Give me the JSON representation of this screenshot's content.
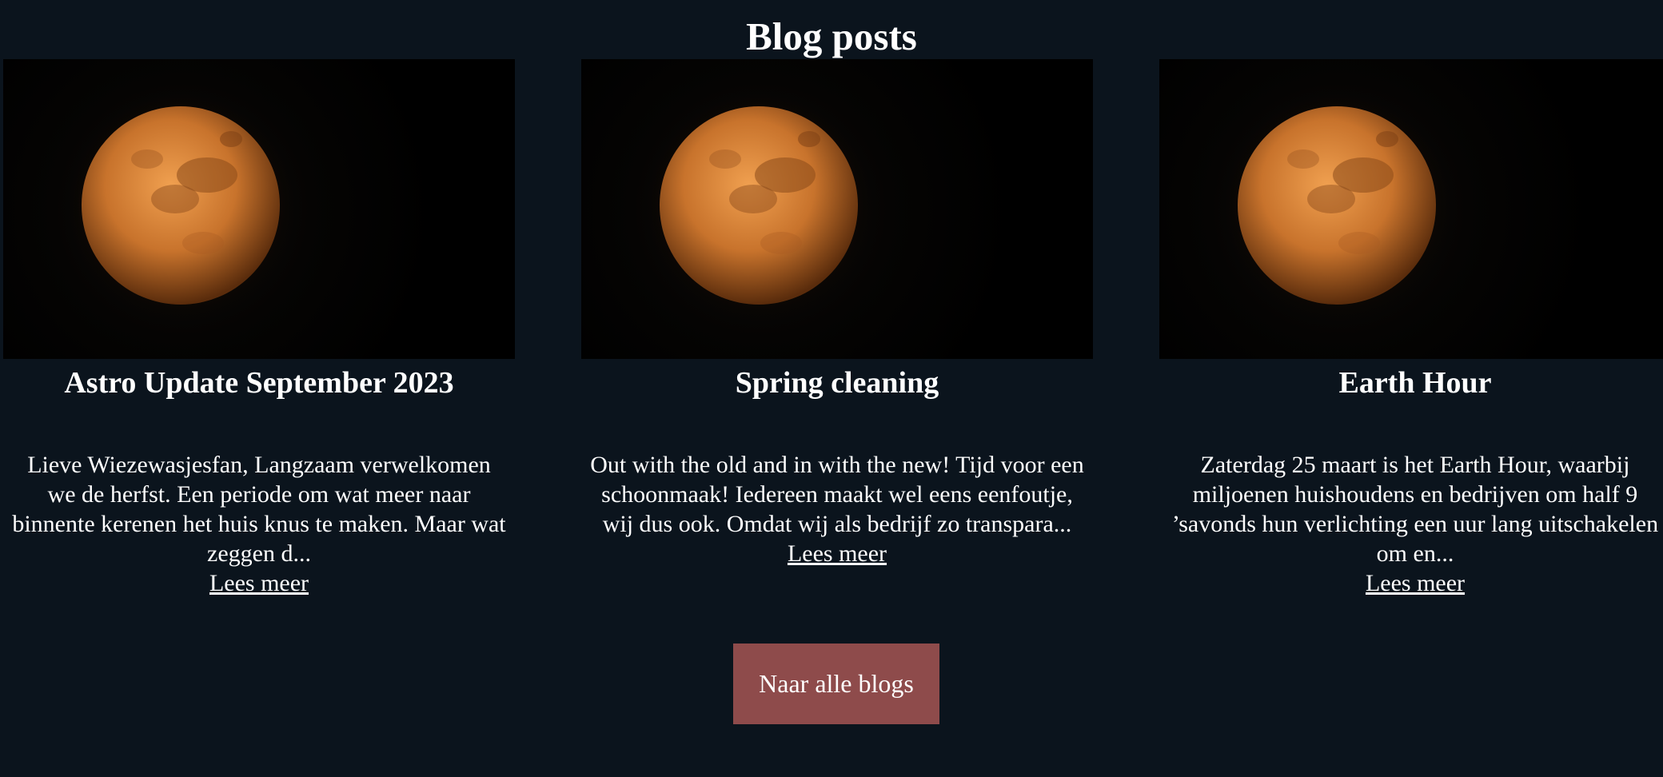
{
  "page": {
    "title": "Blog posts",
    "background_color": "#0b141d"
  },
  "posts": [
    {
      "image_icon": "moon-image",
      "title": "Astro Update September 2023",
      "excerpt": "Lieve Wiezewasjesfan, Langzaam verwelkomen we de herfst. Een periode om wat meer naar binnente kerenen het huis knus te maken. Maar wat zeggen d...",
      "link_label": "Lees meer"
    },
    {
      "image_icon": "moon-image",
      "title": "Spring cleaning",
      "excerpt": "Out with the old and in with the new! Tijd voor een schoonmaak! Iedereen maakt wel eens eenfoutje, wij dus ook. Omdat wij als bedrijf zo transpara...",
      "link_label": "Lees meer"
    },
    {
      "image_icon": "moon-image",
      "title": "Earth Hour",
      "excerpt": "Zaterdag 25 maart is het Earth Hour, waarbij miljoenen huishoudens en bedrijven om half 9 ’savonds hun verlichting een uur lang uitschakelen om en...",
      "link_label": "Lees meer"
    }
  ],
  "footer": {
    "all_blogs_label": "Naar alle blogs",
    "button_color": "#8e4b4b"
  }
}
